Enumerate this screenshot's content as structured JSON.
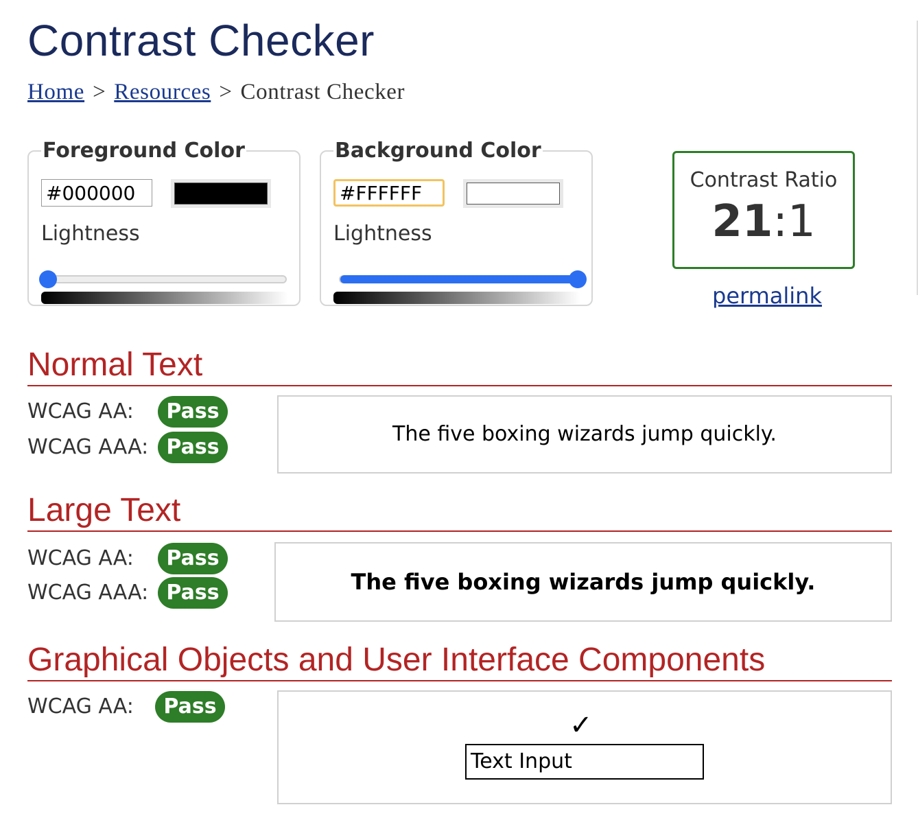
{
  "page": {
    "title": "Contrast Checker"
  },
  "breadcrumb": {
    "items": [
      {
        "label": "Home",
        "link": true
      },
      {
        "label": "Resources",
        "link": true
      },
      {
        "label": "Contrast Checker",
        "link": false
      }
    ],
    "separator": ">"
  },
  "foreground": {
    "legend": "Foreground Color",
    "hex_value": "#000000",
    "swatch_color": "#000000",
    "lightness_label": "Lightness",
    "lightness_value_pct": 0
  },
  "background": {
    "legend": "Background Color",
    "hex_value": "#FFFFFF",
    "swatch_color": "#FFFFFF",
    "lightness_label": "Lightness",
    "lightness_value_pct": 100
  },
  "contrast": {
    "label": "Contrast Ratio",
    "ratio_left": "21",
    "ratio_sep": ":",
    "ratio_right": "1",
    "permalink_label": "permalink"
  },
  "sections": {
    "normal": {
      "heading": "Normal Text",
      "aa_label": "WCAG AA:",
      "aa_result": "Pass",
      "aaa_label": "WCAG AAA:",
      "aaa_result": "Pass",
      "preview_text": "The five boxing wizards jump quickly."
    },
    "large": {
      "heading": "Large Text",
      "aa_label": "WCAG AA:",
      "aa_result": "Pass",
      "aaa_label": "WCAG AAA:",
      "aaa_result": "Pass",
      "preview_text": "The five boxing wizards jump quickly."
    },
    "graphical": {
      "heading": "Graphical Objects and User Interface Components",
      "aa_label": "WCAG AA:",
      "aa_result": "Pass",
      "checkmark": "✓",
      "input_text": "Text Input"
    }
  },
  "colors": {
    "title": "#1b2a5c",
    "link": "#1a3a8f",
    "heading_red": "#b32424",
    "pass_green": "#2e7d28",
    "slider_blue": "#2b6ef2",
    "focus_yellow": "#f2c35f"
  }
}
